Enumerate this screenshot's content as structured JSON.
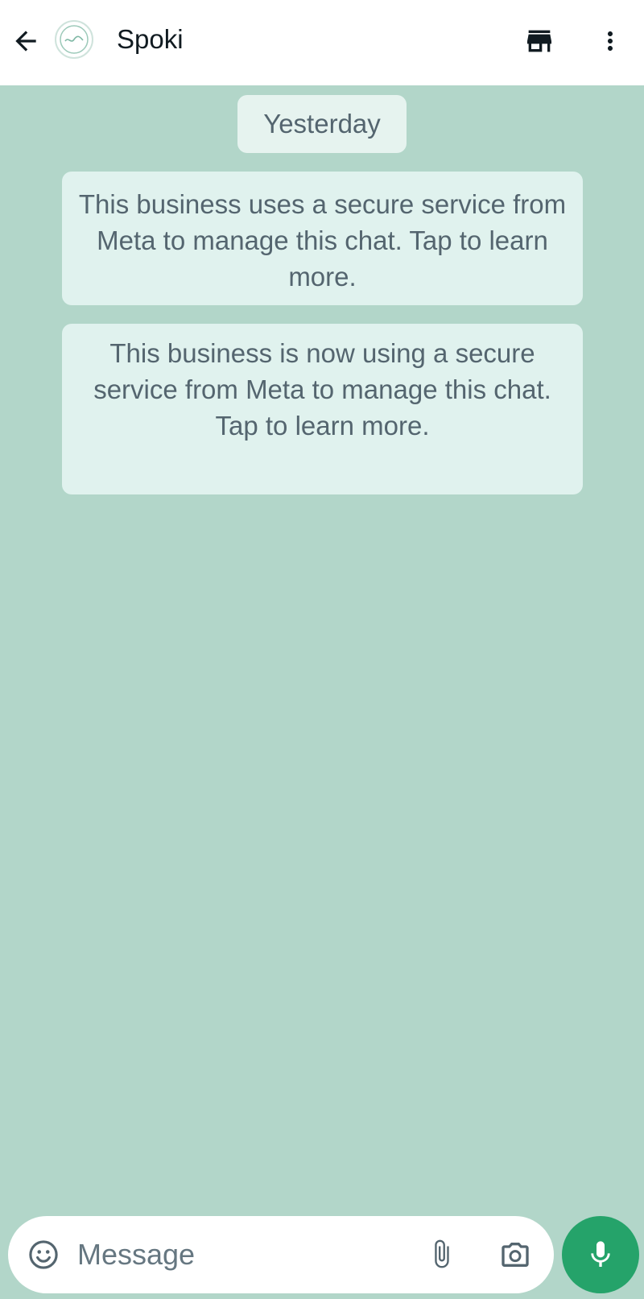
{
  "header": {
    "contact_name": "Spoki",
    "back_icon": "arrow-left-icon",
    "avatar_icon": "business-logo-icon",
    "shop_icon": "storefront-icon",
    "menu_icon": "more-vertical-icon"
  },
  "chat": {
    "date_divider": "Yesterday",
    "messages": [
      {
        "text": "This business uses a secure service from Meta to manage this chat. Tap to learn more."
      },
      {
        "text": "This business is now using a secure service from Meta to manage this chat. Tap to learn more."
      }
    ]
  },
  "composer": {
    "placeholder": "Message",
    "emoji_icon": "emoji-icon",
    "attach_icon": "paperclip-icon",
    "camera_icon": "camera-icon",
    "mic_icon": "microphone-icon"
  },
  "colors": {
    "chat_background": "#b2d6c9",
    "bubble": "#e0f2ee",
    "accent": "#25a36a"
  }
}
